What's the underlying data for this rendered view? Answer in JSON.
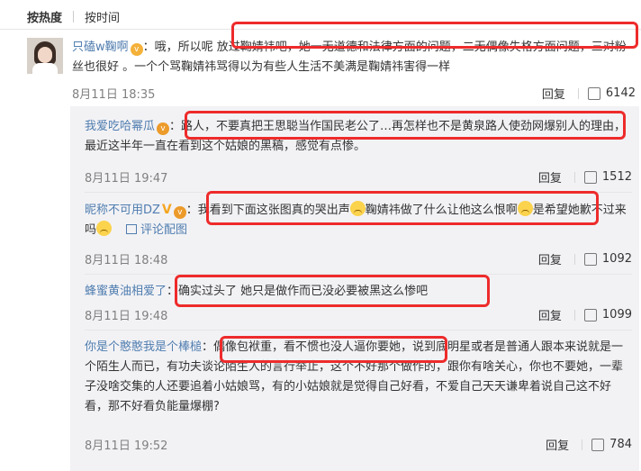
{
  "tabs": {
    "hot": "按热度",
    "time": "按时间"
  },
  "main": {
    "username": "只磕w鞠啊",
    "text": "：哦，所以呢  放过鞠婧祎吧，她一无道德和法律方面的问题，二无偶像失格方面问题，三对粉丝也很好 。一个个骂鞠婧祎骂得以为有些人生活不美满是鞠婧祎害得一样",
    "time": "8月11日 18:35",
    "reply": "回复",
    "likes": "6142"
  },
  "replies": [
    {
      "username": "我爱吃哈幂瓜",
      "text": "：路人，不要真把王思聪当作国民老公了…再怎样也不是黄泉路人使劲网爆别人的理由，最近这半年一直在看到这个姑娘的黑稿，感觉有点惨。",
      "time": "8月11日 19:47",
      "reply": "回复",
      "likes": "1512"
    },
    {
      "username": "昵称不可用DZ",
      "text_a": "：我看到下面这张图真的哭出声",
      "text_b": "鞠婧祎做了什么让他这么恨啊",
      "text_c": "是希望她歉不过来吗",
      "image_link": "评论配图",
      "time": "8月11日 18:48",
      "reply": "回复",
      "likes": "1092"
    },
    {
      "username": "蜂蜜黄油相爱了",
      "text": "：确实过头了 她只是做作而已没必要被黑这么惨吧",
      "time": "8月11日 19:48",
      "reply": "回复",
      "likes": "1099"
    },
    {
      "username": "你是个憨憨我是个棒槌",
      "text": "：偶像包袱重，看不惯也没人逼你要她，说到底明星或者是普通人跟本来说就是一个陌生人而已，有功夫谈论陌生人的言行举止，这个不好那个做作的，跟你有啥关心，你也不要她，一辈子没啥交集的人还要追着小姑娘骂，有的小姑娘就是觉得自己好看，不爱自己天天谦卑着说自己这不好看，那不好看负能量爆棚?",
      "time": "8月11日 19:52",
      "reply": "回复",
      "likes": "784"
    }
  ]
}
